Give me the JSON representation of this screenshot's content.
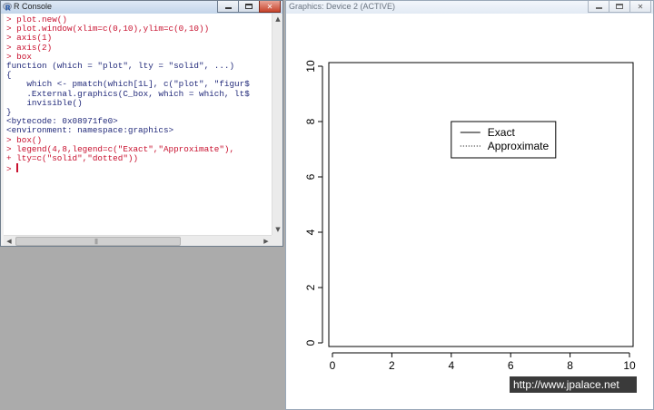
{
  "console": {
    "title": "R Console",
    "lines": [
      {
        "text": "> plot.new()",
        "kind": "cmd"
      },
      {
        "text": "> plot.window(xlim=c(0,10),ylim=c(0,10))",
        "kind": "cmd"
      },
      {
        "text": "> axis(1)",
        "kind": "cmd"
      },
      {
        "text": "> axis(2)",
        "kind": "cmd"
      },
      {
        "text": "> box",
        "kind": "cmd"
      },
      {
        "text": "function (which = \"plot\", lty = \"solid\", ...)",
        "kind": "out"
      },
      {
        "text": "{",
        "kind": "out"
      },
      {
        "text": "    which <- pmatch(which[1L], c(\"plot\", \"figur$",
        "kind": "out"
      },
      {
        "text": "    .External.graphics(C_box, which = which, lt$",
        "kind": "out"
      },
      {
        "text": "    invisible()",
        "kind": "out"
      },
      {
        "text": "}",
        "kind": "out"
      },
      {
        "text": "<bytecode: 0x08971fe0>",
        "kind": "out"
      },
      {
        "text": "<environment: namespace:graphics>",
        "kind": "out"
      },
      {
        "text": "> box()",
        "kind": "cmd"
      },
      {
        "text": "> legend(4,8,legend=c(\"Exact\",\"Approximate\"),",
        "kind": "cmd"
      },
      {
        "text": "+ lty=c(\"solid\",\"dotted\"))",
        "kind": "cmd"
      }
    ],
    "prompt": ">",
    "text_color": "#222a7a",
    "input_color": "#c8102e"
  },
  "graphics": {
    "title": "Graphics: Device 2 (ACTIVE)"
  },
  "chart_data": {
    "type": "line",
    "xlim": [
      0,
      10
    ],
    "ylim": [
      0,
      10
    ],
    "x_ticks": [
      0,
      2,
      4,
      6,
      8,
      10
    ],
    "y_ticks": [
      0,
      2,
      4,
      6,
      8,
      10
    ],
    "xlabel": "",
    "ylabel": "",
    "grid": false,
    "series": [],
    "legend": {
      "anchor": [
        4,
        8
      ],
      "entries": [
        {
          "label": "Exact",
          "lty": "solid"
        },
        {
          "label": "Approximate",
          "lty": "dotted"
        }
      ]
    }
  },
  "watermark": "http://www.jpalace.net",
  "icons": [
    "r-logo-icon",
    "minimize-icon",
    "maximize-icon",
    "close-icon",
    "scroll-left-icon",
    "scroll-right-icon",
    "scroll-up-icon",
    "scroll-down-icon"
  ]
}
